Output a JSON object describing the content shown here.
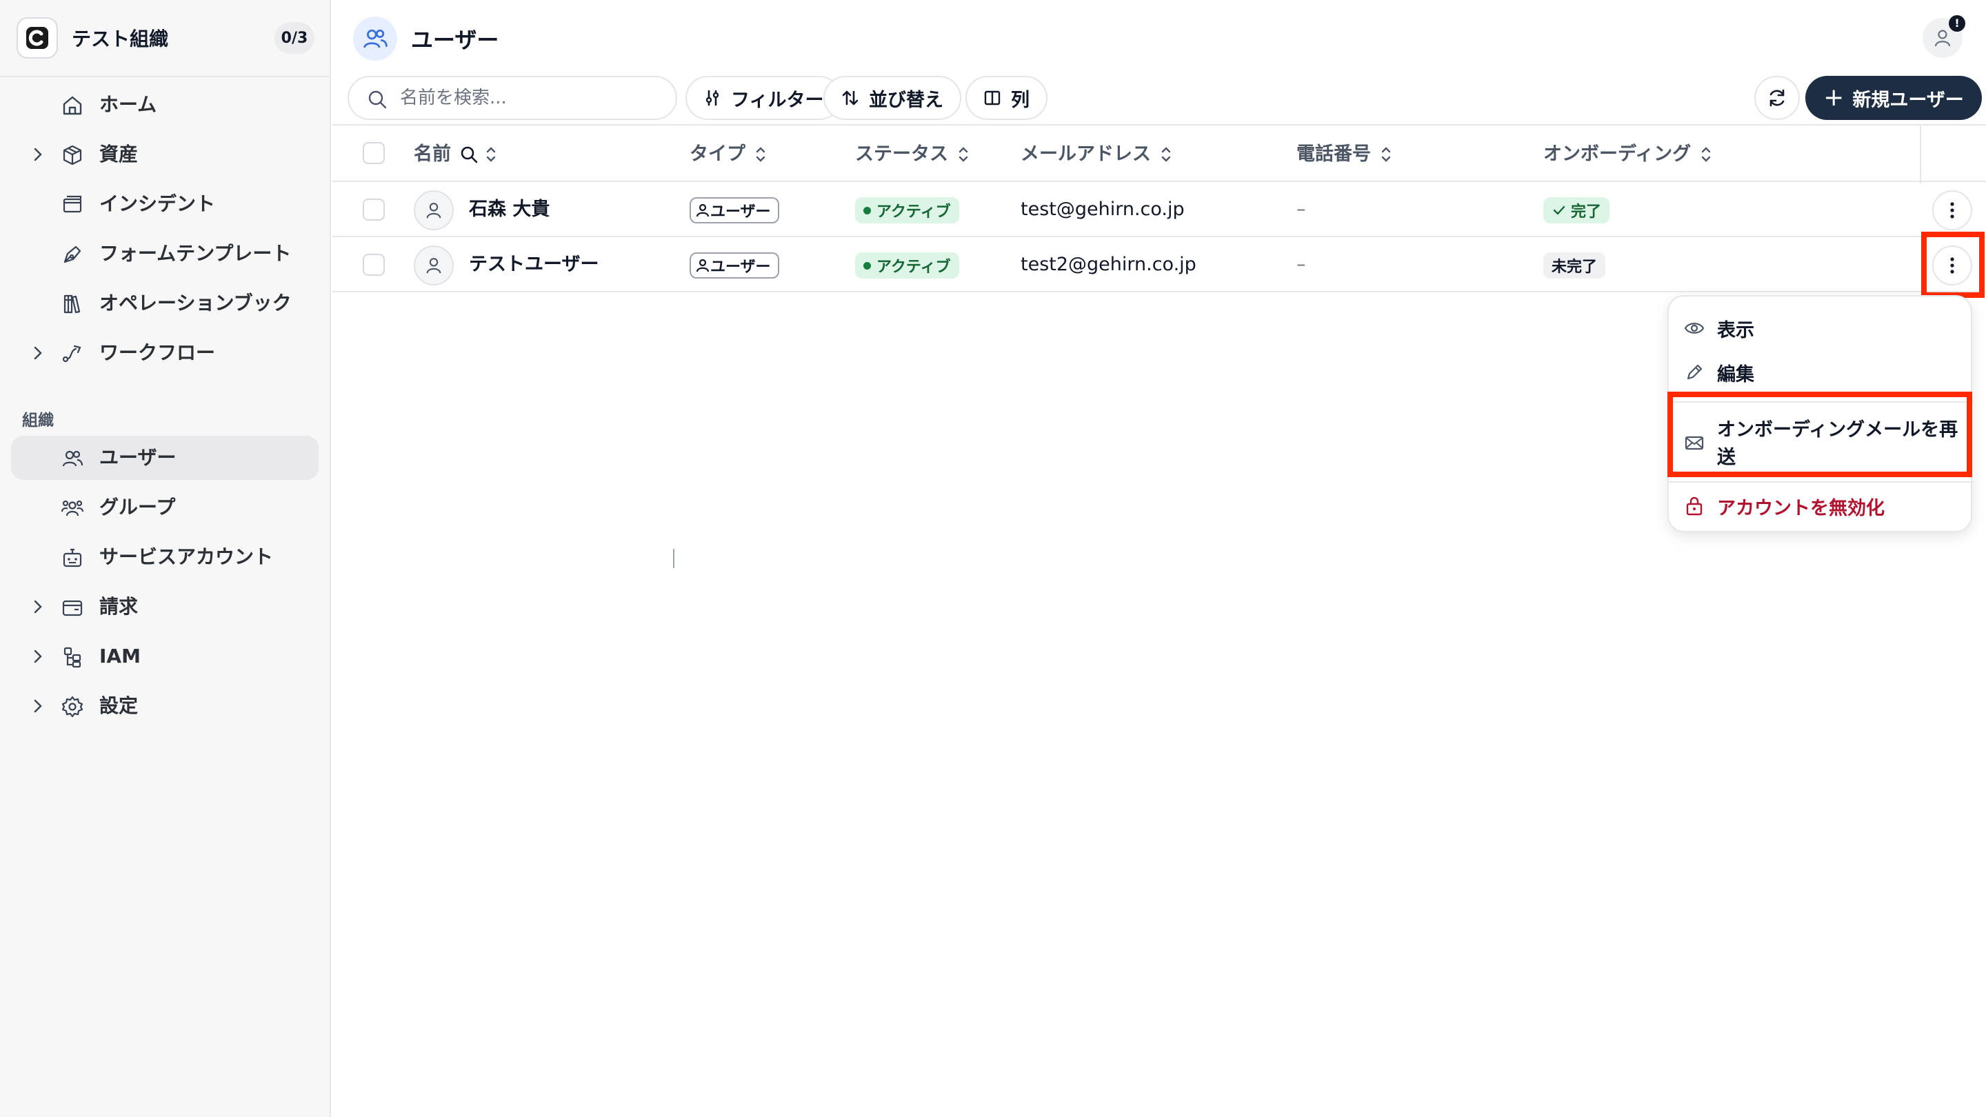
{
  "org": {
    "name": "テスト組織",
    "count": "0/3"
  },
  "sidebar": {
    "items": [
      {
        "label": "ホーム",
        "icon": "home-icon",
        "chevron": false
      },
      {
        "label": "資産",
        "icon": "cube-icon",
        "chevron": true
      },
      {
        "label": "インシデント",
        "icon": "window-icon",
        "chevron": false
      },
      {
        "label": "フォームテンプレート",
        "icon": "pen-nib-icon",
        "chevron": false
      },
      {
        "label": "オペレーションブック",
        "icon": "books-icon",
        "chevron": false
      },
      {
        "label": "ワークフロー",
        "icon": "workflow-icon",
        "chevron": true
      }
    ],
    "section_label": "組織",
    "org_items": [
      {
        "label": "ユーザー",
        "icon": "users-icon",
        "chevron": false,
        "active": true
      },
      {
        "label": "グループ",
        "icon": "group-icon",
        "chevron": false
      },
      {
        "label": "サービスアカウント",
        "icon": "robot-icon",
        "chevron": false
      },
      {
        "label": "請求",
        "icon": "wallet-icon",
        "chevron": true
      },
      {
        "label": "IAM",
        "icon": "iam-icon",
        "chevron": true
      },
      {
        "label": "設定",
        "icon": "gear-icon",
        "chevron": true
      }
    ]
  },
  "page": {
    "title": "ユーザー",
    "alert_badge": "!"
  },
  "toolbar": {
    "search_placeholder": "名前を検索...",
    "filter_label": "フィルター",
    "sort_label": "並び替え",
    "columns_label": "列",
    "new_user_label": "新規ユーザー"
  },
  "table": {
    "headers": [
      "名前",
      "タイプ",
      "ステータス",
      "メールアドレス",
      "電話番号",
      "オンボーディング"
    ],
    "rows": [
      {
        "name": "石森 大貴",
        "type": "ユーザー",
        "status": "アクティブ",
        "email": "test@gehirn.co.jp",
        "phone": "–",
        "onboarding": "完了",
        "onboarding_done": true
      },
      {
        "name": "テストユーザー",
        "type": "ユーザー",
        "status": "アクティブ",
        "email": "test2@gehirn.co.jp",
        "phone": "–",
        "onboarding": "未完了",
        "onboarding_done": false
      }
    ]
  },
  "menu": {
    "items": [
      {
        "label": "表示",
        "icon": "eye-icon"
      },
      {
        "label": "編集",
        "icon": "pencil-icon"
      },
      {
        "label": "オンボーディングメールを再送",
        "label_line2": "送",
        "label_line1": "オンボーディングメールを再",
        "icon": "mail-icon"
      },
      {
        "label": "アカウントを無効化",
        "icon": "lock-icon",
        "danger": true
      }
    ]
  },
  "colors": {
    "highlight": "#ff2a00",
    "primary_button": "#1c2d44",
    "active_badge_bg": "#dcf5e6",
    "active_badge_text": "#166534",
    "danger": "#b3122e"
  }
}
